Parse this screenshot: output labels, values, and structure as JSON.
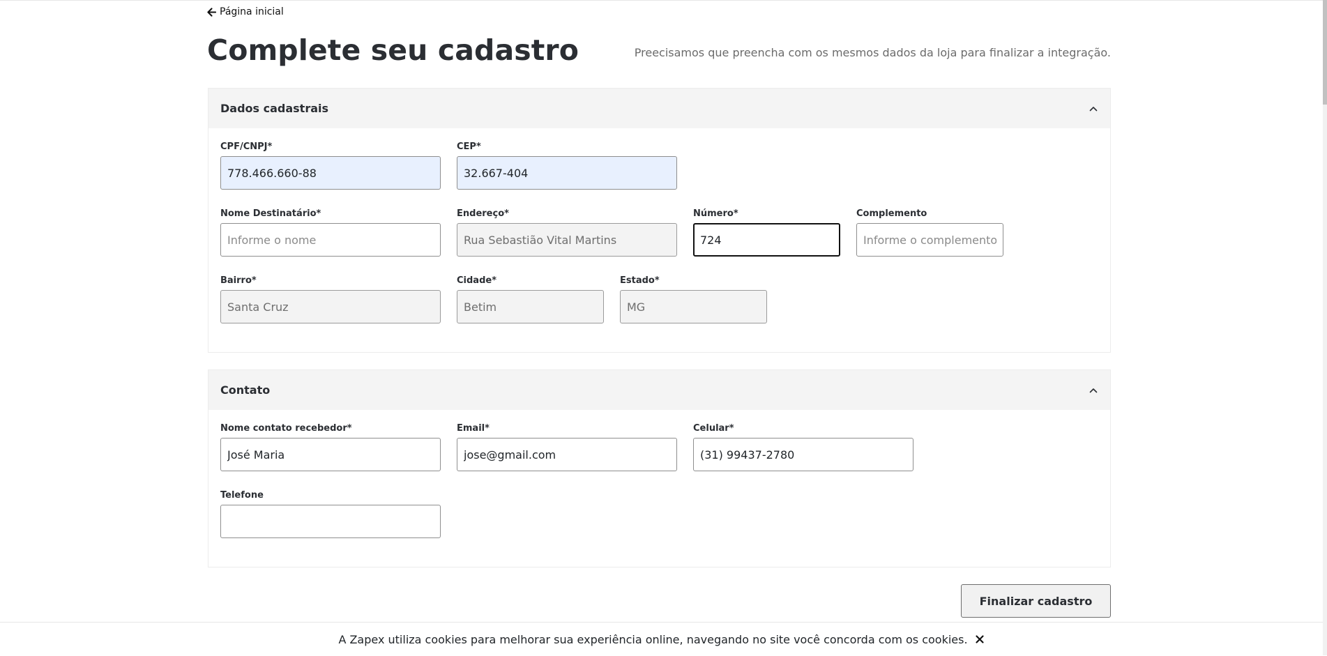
{
  "nav": {
    "back_label": "Página inicial"
  },
  "header": {
    "title": "Complete seu cadastro",
    "subtitle": "Preecisamos que preencha com os mesmos dados da loja para finalizar a integração."
  },
  "sections": {
    "dados": {
      "title": "Dados cadastrais",
      "cpf": {
        "label": "CPF/CNPJ*",
        "value": "778.466.660-88"
      },
      "cep": {
        "label": "CEP*",
        "value": "32.667-404"
      },
      "nome": {
        "label": "Nome Destinatário*",
        "placeholder": "Informe o nome"
      },
      "endereco": {
        "label": "Endereço*",
        "value": "Rua Sebastião Vital Martins"
      },
      "numero": {
        "label": "Número*",
        "value": "724"
      },
      "complemento": {
        "label": "Complemento",
        "placeholder": "Informe o complemento"
      },
      "bairro": {
        "label": "Bairro*",
        "value": "Santa Cruz"
      },
      "cidade": {
        "label": "Cidade*",
        "value": "Betim"
      },
      "estado": {
        "label": "Estado*",
        "value": "MG"
      }
    },
    "contato": {
      "title": "Contato",
      "nome_contato": {
        "label": "Nome contato recebedor*",
        "value": "José Maria"
      },
      "email": {
        "label": "Email*",
        "value": "jose@gmail.com"
      },
      "celular": {
        "label": "Celular*",
        "value": "(31) 99437-2780"
      },
      "telefone": {
        "label": "Telefone",
        "value": ""
      }
    }
  },
  "actions": {
    "finish_label": "Finalizar cadastro"
  },
  "cookie": {
    "text": "A Zapex utiliza cookies para melhorar sua experiência online, navegando no site você concorda com os cookies."
  },
  "icons": {
    "back": "arrow-left-icon",
    "collapse": "chevron-up-icon",
    "close": "close-icon"
  }
}
